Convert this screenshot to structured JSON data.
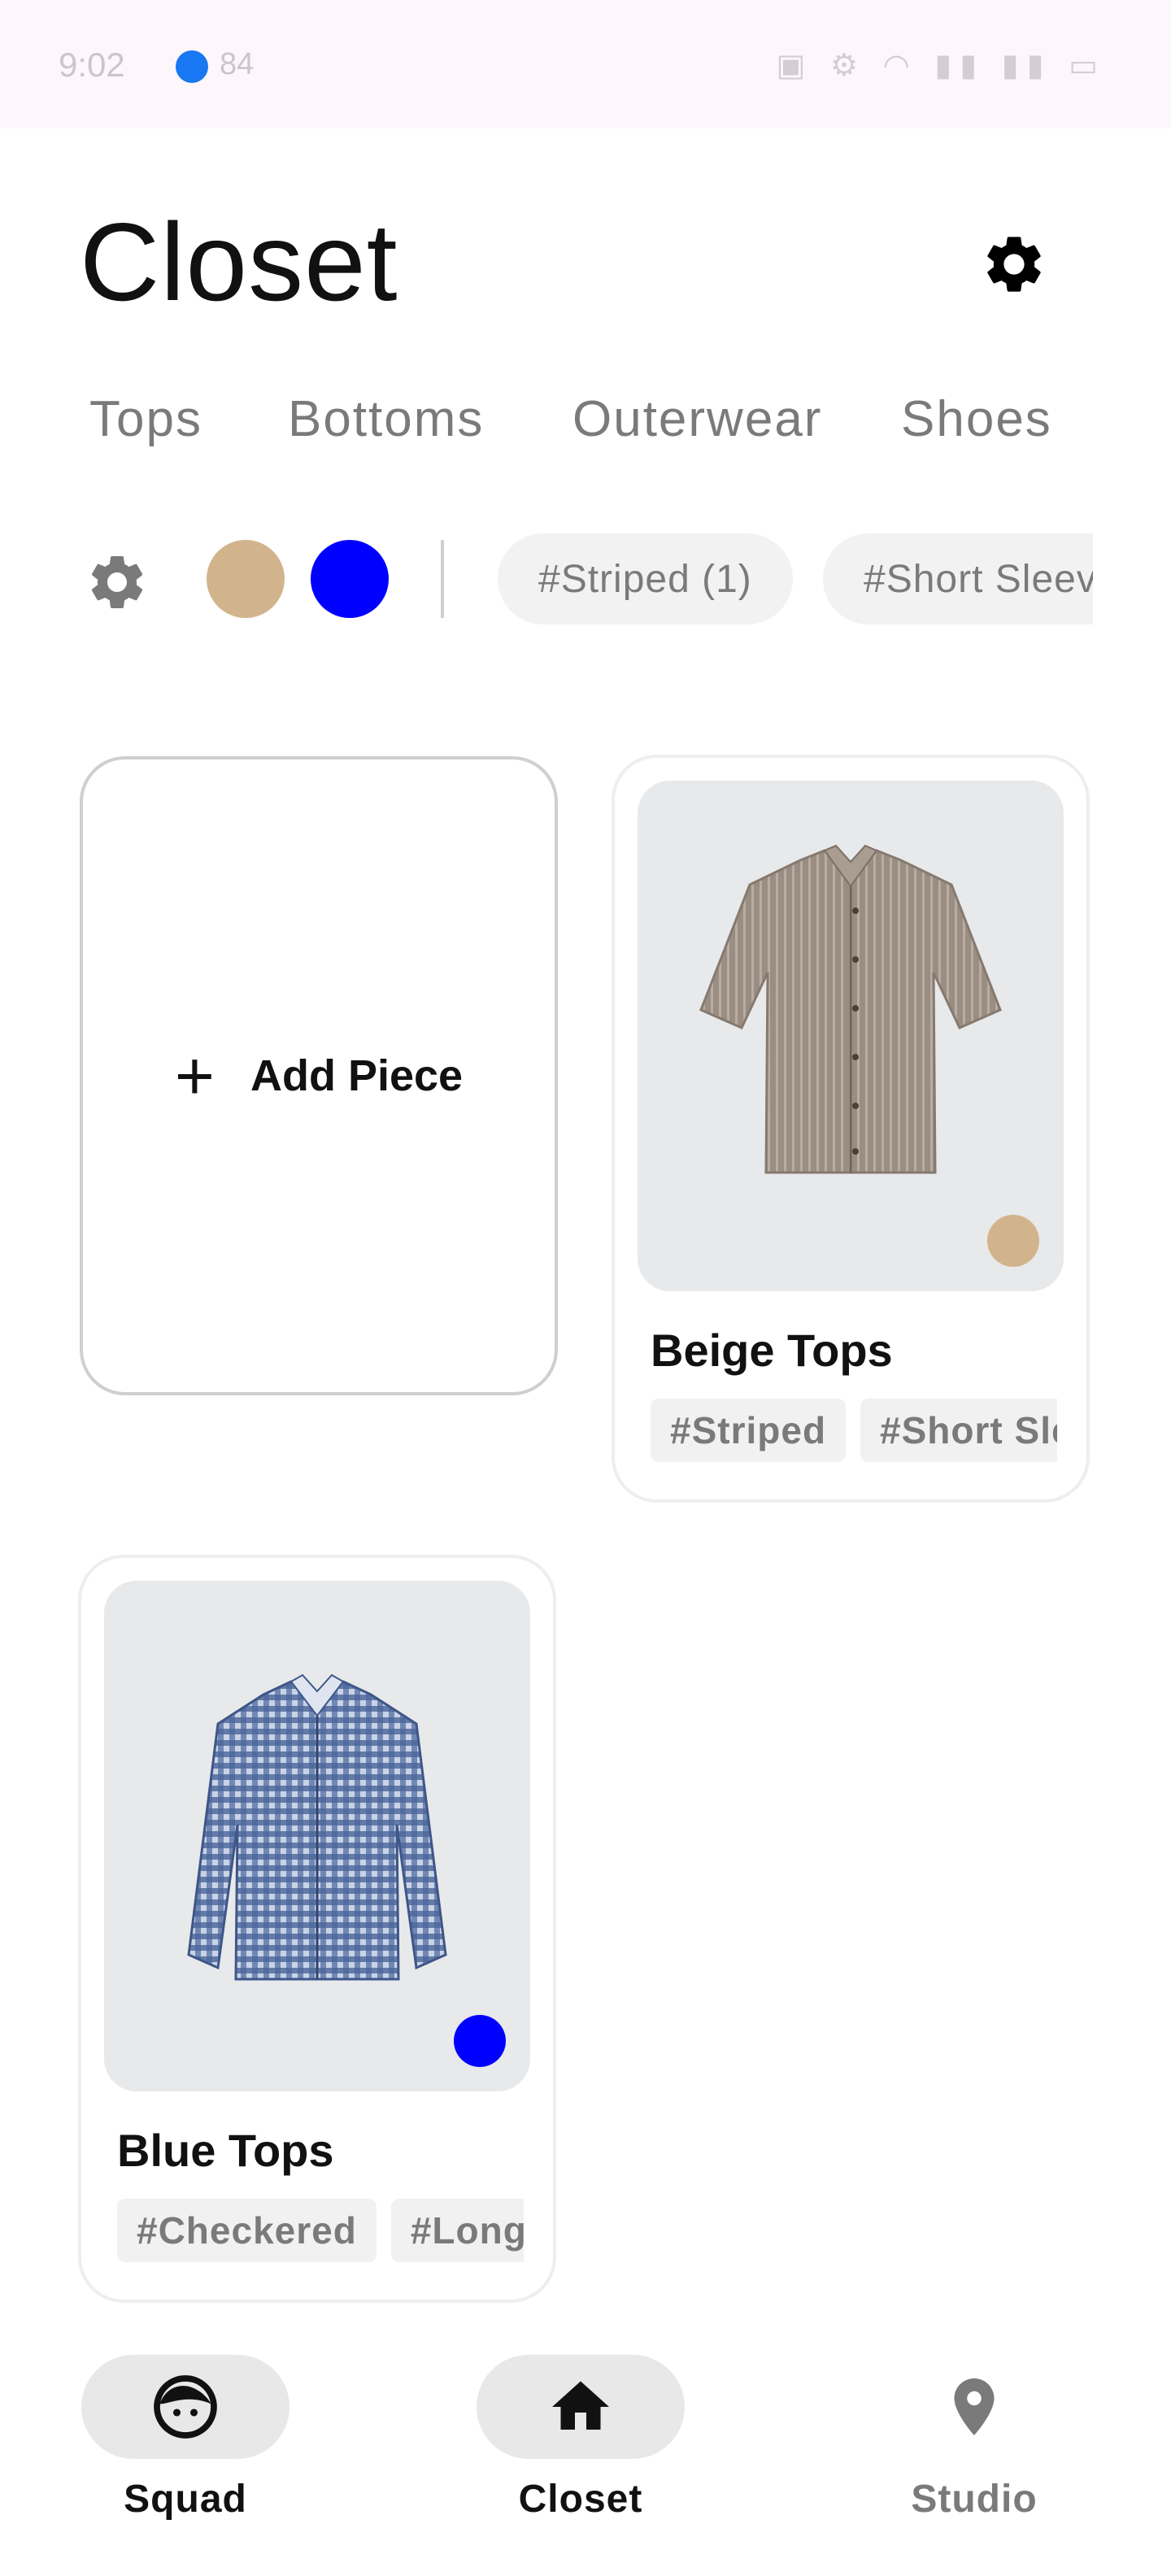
{
  "status_bar": {
    "time": "9:02",
    "messenger_count": "84"
  },
  "header": {
    "title": "Closet"
  },
  "tabs": [
    {
      "label": "Tops",
      "selected": true
    },
    {
      "label": "Bottoms",
      "selected": false
    },
    {
      "label": "Outerwear",
      "selected": false
    },
    {
      "label": "Shoes",
      "selected": false
    }
  ],
  "filters": {
    "color_swatches": [
      "#d2b48c",
      "#0000ff"
    ],
    "chips": [
      "#Striped (1)",
      "#Short Sleev"
    ]
  },
  "add_piece": {
    "plus": "+",
    "label": "Add Piece"
  },
  "items": [
    {
      "title": "Beige Tops",
      "color": "#d2b48c",
      "tags": [
        "#Striped",
        "#Short Sle"
      ],
      "image": "beige-striped-short-sleeve-shirt"
    },
    {
      "title": "Blue Tops",
      "color": "#0000ff",
      "tags": [
        "#Checkered",
        "#Long"
      ],
      "image": "blue-checkered-long-sleeve-shirt"
    }
  ],
  "bottom_nav": [
    {
      "label": "Squad",
      "icon": "face-icon",
      "active_pill": true,
      "color": "#111111"
    },
    {
      "label": "Closet",
      "icon": "home-icon",
      "active_pill": true,
      "color": "#111111"
    },
    {
      "label": "Studio",
      "icon": "location-pin-icon",
      "active_pill": false,
      "color": "#7a7a7a"
    }
  ],
  "colors": {
    "pill_bg": "#e8e8e8",
    "muted_text": "#7a7a7a",
    "accent_beige": "#d2b48c",
    "accent_blue": "#0000ff"
  }
}
